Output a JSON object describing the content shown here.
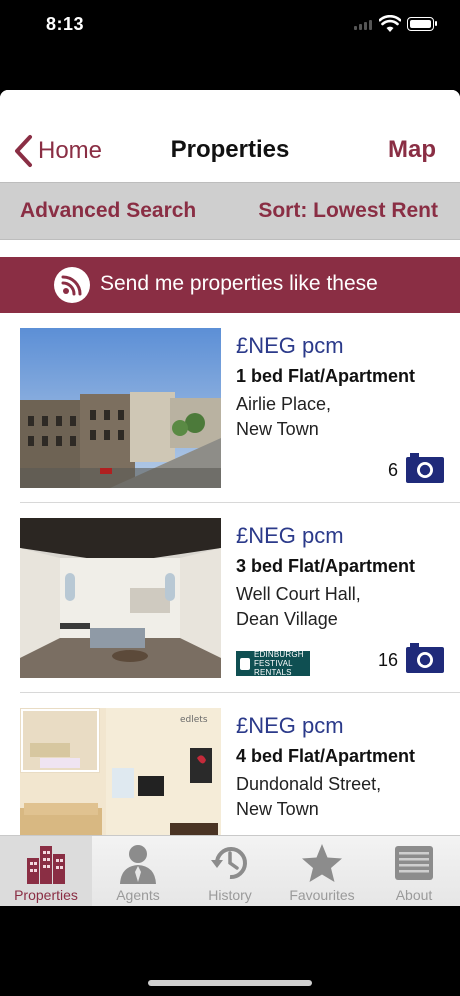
{
  "status": {
    "time": "8:13"
  },
  "nav": {
    "back_label": "Home",
    "title": "Properties",
    "map_label": "Map"
  },
  "filters": {
    "advanced_label": "Advanced Search",
    "sort_label": "Sort: Lowest Rent"
  },
  "alert": {
    "label": "Send me properties like these"
  },
  "listings": [
    {
      "price": "£NEG pcm",
      "type": "1 bed Flat/Apartment",
      "addr1": "Airlie Place,",
      "addr2": "New Town",
      "photos": "6"
    },
    {
      "price": "£NEG pcm",
      "type": "3 bed Flat/Apartment",
      "addr1": "Well Court Hall,",
      "addr2": "Dean Village",
      "photos": "16",
      "agent_logo_line1": "EDINBURGH",
      "agent_logo_line2": "FESTIVAL RENTALS"
    },
    {
      "price": "£NEG pcm",
      "type": "4 bed Flat/Apartment",
      "addr1": "Dundonald Street,",
      "addr2": "New Town",
      "watermark": "edlets"
    }
  ],
  "tabs": [
    {
      "label": "Properties",
      "icon": "buildings-icon",
      "active": true
    },
    {
      "label": "Agents",
      "icon": "person-icon",
      "active": false
    },
    {
      "label": "History",
      "icon": "clock-history-icon",
      "active": false
    },
    {
      "label": "Favourites",
      "icon": "star-icon",
      "active": false
    },
    {
      "label": "About",
      "icon": "document-icon",
      "active": false
    }
  ],
  "colors": {
    "brand": "#8a2e44",
    "price": "#2b3a8a",
    "agent_logo_bg": "#0f4f52"
  }
}
